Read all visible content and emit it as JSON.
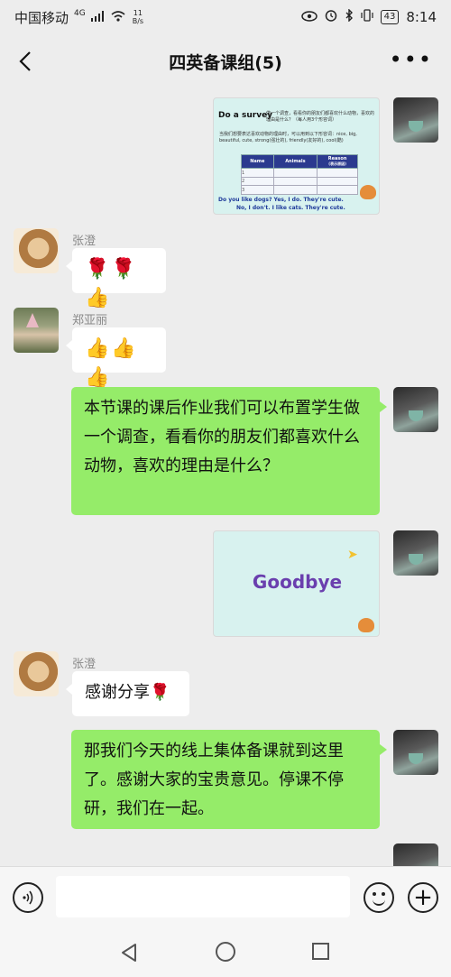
{
  "status_bar": {
    "carrier": "中国移动",
    "network": "4G",
    "speed_value": "11",
    "speed_unit": "B/s",
    "battery": "43",
    "time": "8:14"
  },
  "header": {
    "title": "四英备课组(5)",
    "more_label": "•••"
  },
  "messages": [
    {
      "type": "image",
      "from": "self",
      "slide": {
        "title": "Do a survey",
        "subtitle": "做一个调查，看看你的朋友们都喜欢什么动物，喜欢的理由是什么？（每人用3个形容词）",
        "hint": "当我们想要表达喜欢动物的理由时，可以用到以下形容词：nice, big, beautiful, cute, strong(强壮的), friendly(友好的), cool(酷)",
        "table_headers": [
          "Name",
          "Animals",
          "Reason"
        ],
        "table_sub": "(表示原因)",
        "table_rows": [
          "1",
          "2",
          "3"
        ],
        "footer_line1": "Do you like dogs? Yes, I do. They're cute.",
        "footer_line2": "No, I don't. I like cats. They're cute."
      }
    },
    {
      "type": "text",
      "from": "张澄",
      "content": "🌹🌹👍"
    },
    {
      "type": "text",
      "from": "郑亚丽",
      "content": "👍👍👍"
    },
    {
      "type": "text",
      "from": "self",
      "content": "本节课的课后作业我们可以布置学生做一个调查，看看你的朋友们都喜欢什么动物，喜欢的理由是什么？"
    },
    {
      "type": "image",
      "from": "self",
      "slide": {
        "title": "Goodbye"
      }
    },
    {
      "type": "text",
      "from": "张澄",
      "content": "感谢分享🌹"
    },
    {
      "type": "text",
      "from": "self",
      "content": "那我们今天的线上集体备课就到这里了。感谢大家的宝贵意见。停课不停研，我们在一起。"
    }
  ],
  "input": {
    "placeholder": ""
  },
  "colors": {
    "bubble_self": "#95ec69",
    "bubble_other": "#ffffff",
    "background": "#ededed"
  }
}
